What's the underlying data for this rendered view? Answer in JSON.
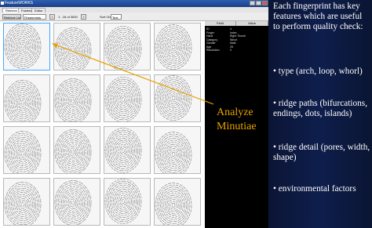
{
  "window": {
    "title": "FeatureWORKS"
  },
  "tabs": [
    "Retrieve",
    "Folders",
    "Editor"
  ],
  "toolbar": {
    "left_button": "Retrieve List",
    "mode_value": "Fingerprints",
    "page_range": "1 - 16 of 3000",
    "sort_label": "Sort Order:",
    "sort_value": "Text"
  },
  "properties": {
    "headers": [
      "Field",
      "Value"
    ],
    "rows": [
      [
        "ID",
        "4"
      ],
      [
        "Finger",
        "Index"
      ],
      [
        "Hand",
        "Right Thumb"
      ],
      [
        "Category",
        "Whorl"
      ],
      [
        "Gender",
        "Male"
      ],
      [
        "Age",
        "25"
      ],
      [
        "Resolution",
        "0"
      ]
    ]
  },
  "thumbnails_selected_index": 0,
  "callout": {
    "line1": "Analyze",
    "line2": "Minutiae",
    "color": "#e8a200"
  },
  "info": {
    "intro": "Each fingerprint has key features which are useful to perform quality check:",
    "bullets": [
      "• type (arch, loop, whorl)",
      "• ridge paths (bifurcations, endings, dots, islands)",
      "• ridge detail (pores, width, shape)",
      "• environmental factors"
    ]
  },
  "icons": [
    "window-minimize-icon",
    "window-maximize-icon",
    "window-close-icon",
    "prev-page-icon",
    "next-page-icon"
  ]
}
